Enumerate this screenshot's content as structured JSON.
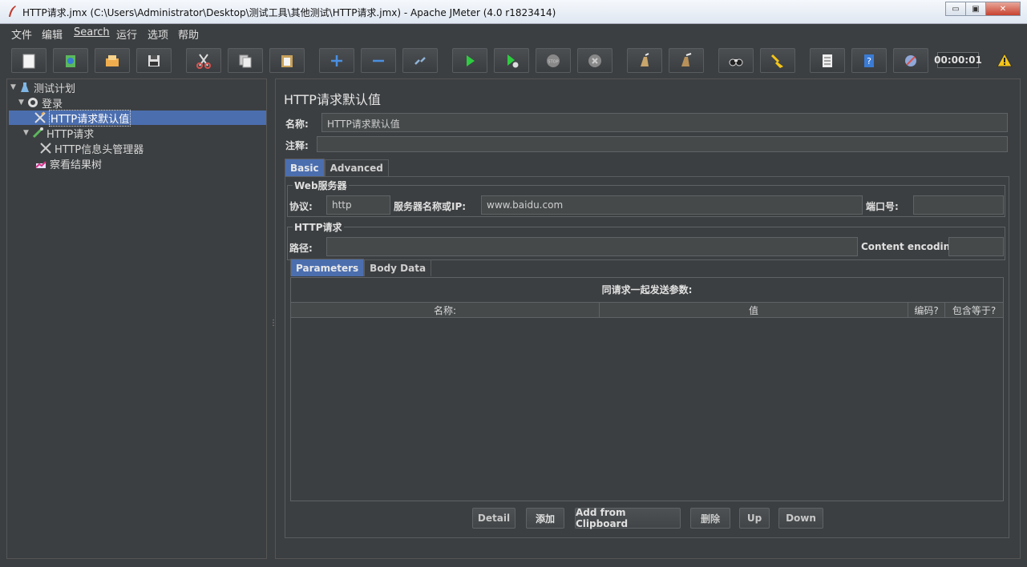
{
  "window": {
    "title": "HTTP请求.jmx (C:\\Users\\Administrator\\Desktop\\测试工具\\其他测试\\HTTP请求.jmx) - Apache JMeter (4.0 r1823414)",
    "minimize": "▭",
    "restore": "▣",
    "close": "✕"
  },
  "menu": [
    "文件",
    "编辑",
    "Search",
    "运行",
    "选项",
    "帮助"
  ],
  "toolbar": {
    "icons": [
      "new-icon",
      "templates-icon",
      "open-icon",
      "save-icon",
      "cut-icon",
      "copy-icon",
      "paste-icon",
      "expand-icon",
      "collapse-icon",
      "toggle-icon",
      "start-icon",
      "start-no-pause-icon",
      "stop-icon",
      "shutdown-icon",
      "clear-icon",
      "clear-all-icon",
      "search-icon",
      "reset-search-icon",
      "function-helper-icon",
      "help-icon",
      "remote-icon"
    ],
    "timer": "00:00:01"
  },
  "tree": {
    "items": [
      {
        "label": "测试计划",
        "icon": "flask-icon"
      },
      {
        "label": "登录",
        "icon": "gear-icon"
      },
      {
        "label": "HTTP请求默认值",
        "icon": "tools-icon"
      },
      {
        "label": "HTTP请求",
        "icon": "pipette-icon"
      },
      {
        "label": "HTTP信息头管理器",
        "icon": "tools-icon"
      },
      {
        "label": "察看结果树",
        "icon": "chart-icon"
      }
    ]
  },
  "panel": {
    "title": "HTTP请求默认值",
    "name_label": "名称:",
    "name_value": "HTTP请求默认值",
    "comment_label": "注释:",
    "comment_value": "",
    "tabs": [
      "Basic",
      "Advanced"
    ],
    "web_server": {
      "group_title": "Web服务器",
      "protocol_label": "协议:",
      "protocol_value": "http",
      "server_label": "服务器名称或IP:",
      "server_value": "www.baidu.com",
      "port_label": "端口号:",
      "port_value": ""
    },
    "http_request": {
      "group_title": "HTTP请求",
      "path_label": "路径:",
      "path_value": "",
      "encoding_label": "Content encoding:",
      "encoding_value": ""
    },
    "subtabs": [
      "Parameters",
      "Body Data"
    ],
    "params_caption": "同请求一起发送参数:",
    "columns": [
      "名称:",
      "值",
      "编码?",
      "包含等于?"
    ],
    "buttons": [
      "Detail",
      "添加",
      "Add from Clipboard",
      "删除",
      "Up",
      "Down"
    ]
  }
}
